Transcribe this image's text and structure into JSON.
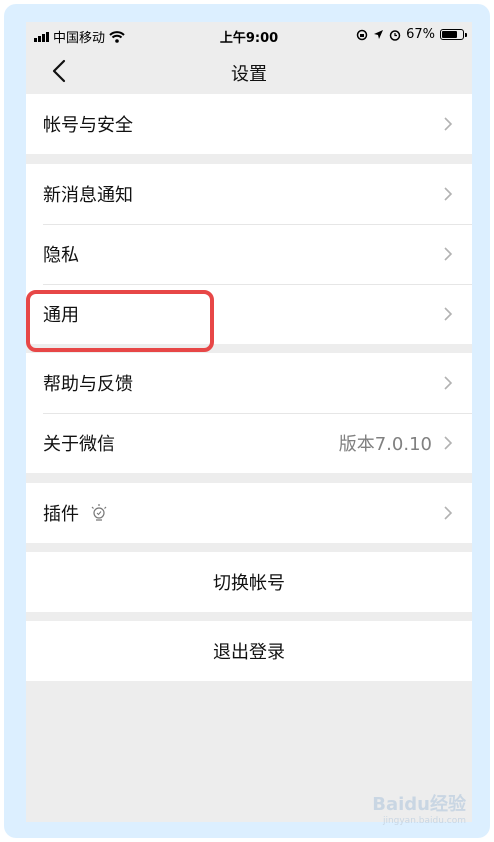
{
  "status_bar": {
    "carrier": "中国移动",
    "time": "上午9:00",
    "battery": "67%",
    "battery_level": 0.67,
    "icons": [
      "signal-icon",
      "wifi-icon",
      "rotation-lock-icon",
      "location-icon",
      "alarm-icon",
      "battery-icon"
    ]
  },
  "nav": {
    "title": "设置",
    "back_icon": "chevron-left-icon"
  },
  "groups": [
    {
      "rows": [
        {
          "label": "帐号与安全"
        }
      ]
    },
    {
      "rows": [
        {
          "label": "新消息通知"
        },
        {
          "label": "隐私"
        },
        {
          "label": "通用"
        }
      ]
    },
    {
      "rows": [
        {
          "label": "帮助与反馈"
        },
        {
          "label": "关于微信",
          "value": "版本7.0.10"
        }
      ]
    },
    {
      "rows": [
        {
          "label": "插件",
          "icon": "lightbulb-icon"
        }
      ]
    }
  ],
  "buttons": {
    "switch_account": "切换帐号",
    "logout": "退出登录"
  },
  "highlight": {
    "target": "通用",
    "color": "#e74747"
  },
  "watermark": {
    "brand": "Baidu经验",
    "url": "jingyan.baidu.com"
  },
  "colors": {
    "background": "#ededed",
    "frame": "#dcefff",
    "row": "#ffffff"
  }
}
